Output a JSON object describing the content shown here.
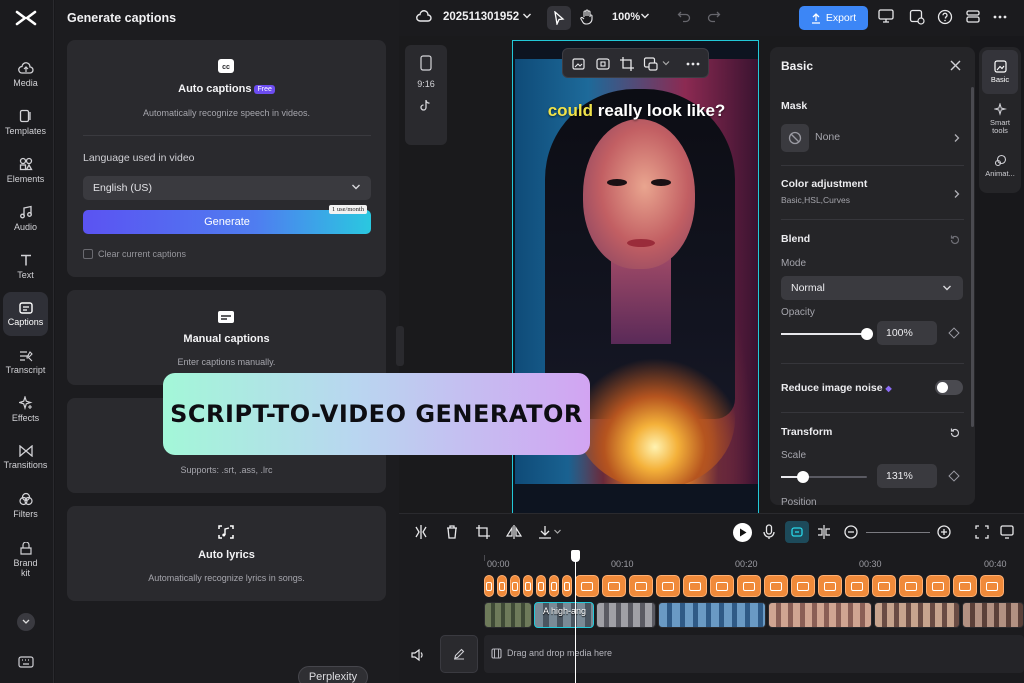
{
  "sidebar": {
    "items": [
      {
        "label": "Media",
        "icon": "cloud-icon"
      },
      {
        "label": "Templates",
        "icon": "templates-icon"
      },
      {
        "label": "Elements",
        "icon": "elements-icon"
      },
      {
        "label": "Audio",
        "icon": "music-note-icon"
      },
      {
        "label": "Text",
        "icon": "text-icon"
      },
      {
        "label": "Captions",
        "icon": "captions-icon",
        "active": true
      },
      {
        "label": "Transcript",
        "icon": "transcript-icon"
      },
      {
        "label": "Effects",
        "icon": "sparkle-icon"
      },
      {
        "label": "Transitions",
        "icon": "transitions-icon"
      },
      {
        "label": "Filters",
        "icon": "filters-icon"
      },
      {
        "label": "Brand kit",
        "icon": "brand-kit-icon"
      }
    ]
  },
  "captions_panel": {
    "title": "Generate captions",
    "auto": {
      "title": "Auto captions",
      "badge": "Free",
      "description": "Automatically recognize speech in videos.",
      "language_label": "Language used in video",
      "language_value": "English (US)",
      "generate_label": "Generate",
      "usage_tag": "1 use/month",
      "clear_label": "Clear current captions"
    },
    "manual": {
      "title": "Manual captions",
      "description": "Enter captions manually."
    },
    "upload": {
      "description": "Supports: .srt, .ass, .lrc"
    },
    "lyrics": {
      "title": "Auto lyrics",
      "description": "Automatically recognize lyrics in songs."
    }
  },
  "banner": {
    "text": "SCRIPT-TO-VIDEO GENERATOR"
  },
  "perplexity": {
    "label": "Perplexity"
  },
  "topbar": {
    "project_name": "202511301952",
    "zoom": "100%",
    "export_label": "Export"
  },
  "canvas": {
    "ratio_label": "9:16",
    "caption_highlight": "could",
    "caption_rest": " really look like?"
  },
  "properties": {
    "title": "Basic",
    "mask": {
      "title": "Mask",
      "value": "None"
    },
    "color": {
      "title": "Color adjustment",
      "subtitle": "Basic,HSL,Curves"
    },
    "blend": {
      "title": "Blend",
      "mode_label": "Mode",
      "mode_value": "Normal",
      "opacity_label": "Opacity",
      "opacity_value": "100%",
      "opacity_level": 1.0
    },
    "noise": {
      "title": "Reduce image noise",
      "enabled": false
    },
    "transform": {
      "title": "Transform",
      "scale_label": "Scale",
      "scale_value": "131%",
      "scale_level": 0.26,
      "position_label": "Position"
    }
  },
  "right_tabs": [
    {
      "label": "Basic",
      "icon": "image-icon",
      "active": true
    },
    {
      "label": "Smart tools",
      "icon": "sparkle-icon"
    },
    {
      "label": "Animat...",
      "icon": "animation-icon"
    }
  ],
  "timeline": {
    "ticks": [
      "00:00",
      "00:10",
      "00:20",
      "00:30",
      "00:40"
    ],
    "clip_label": "A high-ang",
    "drop_text": "Drag and drop media here"
  },
  "colors": {
    "accent": "#3c86f6",
    "caption_clip": "#f08a3a",
    "selection": "#22c9d9"
  }
}
